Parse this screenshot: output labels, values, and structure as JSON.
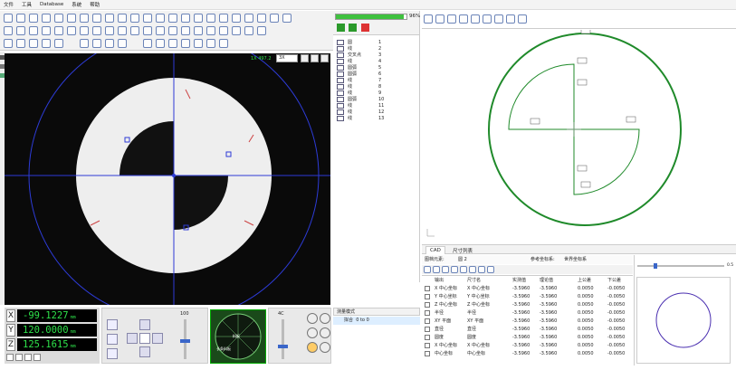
{
  "menu": [
    "文件",
    "工具",
    "Database",
    "系统",
    "帮助"
  ],
  "camera": {
    "scale_label": "3X",
    "readout": "1X 497.2"
  },
  "dro": {
    "x_label": "X",
    "x_value": "-99.1227",
    "y_label": "Y",
    "y_value": "120.0000",
    "z_label": "Z",
    "z_value": "125.1615",
    "unit": "mm"
  },
  "controls": {
    "speed_label": "100",
    "light_label": "4C"
  },
  "mini_view": {
    "label_top": "料板",
    "label_bottom": "长条料板"
  },
  "progress": {
    "percent_text": "96%",
    "fraction": 0.96
  },
  "feature_list": [
    {
      "name": "圆",
      "no": "1"
    },
    {
      "name": "线",
      "no": "2"
    },
    {
      "name": "交叉点",
      "no": "3"
    },
    {
      "name": "线",
      "no": "4"
    },
    {
      "name": "圆弧",
      "no": "5"
    },
    {
      "name": "圆弧",
      "no": "6"
    },
    {
      "name": "线",
      "no": "7"
    },
    {
      "name": "线",
      "no": "8"
    },
    {
      "name": "线",
      "no": "9"
    },
    {
      "name": "圆弧",
      "no": "10"
    },
    {
      "name": "线",
      "no": "11"
    },
    {
      "name": "线",
      "no": "12"
    },
    {
      "name": "线",
      "no": "13"
    }
  ],
  "measure": {
    "header": "测量模式",
    "item": "拟合",
    "item_value": "0 to 0"
  },
  "tabs": [
    "CAD",
    "尺寸列表"
  ],
  "info": {
    "name_label": "图档元素:",
    "name_value": "圆 2",
    "coord_label": "参考坐标系:",
    "coord_value": "世界坐标系"
  },
  "table": {
    "headers": [
      "输出",
      "尺寸名",
      "实测值",
      "理论值",
      "上公差",
      "下公差"
    ],
    "rows": [
      [
        "X 中心坐标",
        "X 中心坐标",
        "-3.5960",
        "-3.5960",
        "0.0050",
        "-0.0050"
      ],
      [
        "Y 中心坐标",
        "Y 中心坐标",
        "-3.5960",
        "-3.5960",
        "0.0050",
        "-0.0050"
      ],
      [
        "Z 中心坐标",
        "Z 中心坐标",
        "-3.5960",
        "-3.5960",
        "0.0050",
        "-0.0050"
      ],
      [
        "半径",
        "半径",
        "-3.5960",
        "-3.5960",
        "0.0050",
        "-0.0050"
      ],
      [
        "XY 平面",
        "XY 平面",
        "-3.5960",
        "-3.5960",
        "0.0050",
        "-0.0050"
      ],
      [
        "直径",
        "直径",
        "-3.5960",
        "-3.5960",
        "0.0050",
        "-0.0050"
      ],
      [
        "圆度",
        "圆度",
        "-3.5960",
        "-3.5960",
        "0.0050",
        "-0.0050"
      ],
      [
        "X 中心坐标",
        "X 中心坐标",
        "-3.5960",
        "-3.5960",
        "0.0050",
        "-0.0050"
      ],
      [
        "中心坐标",
        "中心坐标",
        "-3.5960",
        "-3.5960",
        "0.0050",
        "-0.0050"
      ]
    ]
  },
  "right_panel": {
    "slider_value": "0.5"
  },
  "colors": {
    "cad_green": "#1f8a2a",
    "dro_green": "#2ee04a",
    "crosshair": "#2d3bd6"
  }
}
